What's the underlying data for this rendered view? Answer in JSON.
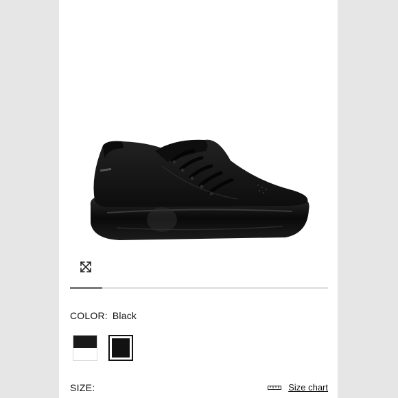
{
  "product": {
    "color_label": "COLOR:",
    "color_value": "Black",
    "size_label": "SIZE:",
    "size_chart_label": "Size chart"
  },
  "swatches": [
    {
      "name": "black-white",
      "selected": false,
      "colors": [
        "#1a1a1a",
        "#ffffff"
      ]
    },
    {
      "name": "black",
      "selected": true,
      "colors": [
        "#121212"
      ]
    }
  ],
  "gallery": {
    "progress_fraction": 0.125
  },
  "icons": {
    "expand": "expand-arrows-icon",
    "ruler": "ruler-icon"
  },
  "colors": {
    "shoe": "#141414",
    "sole": "#0a0a0a",
    "background": "#ffffff",
    "page_margin": "#e6e6e6"
  }
}
